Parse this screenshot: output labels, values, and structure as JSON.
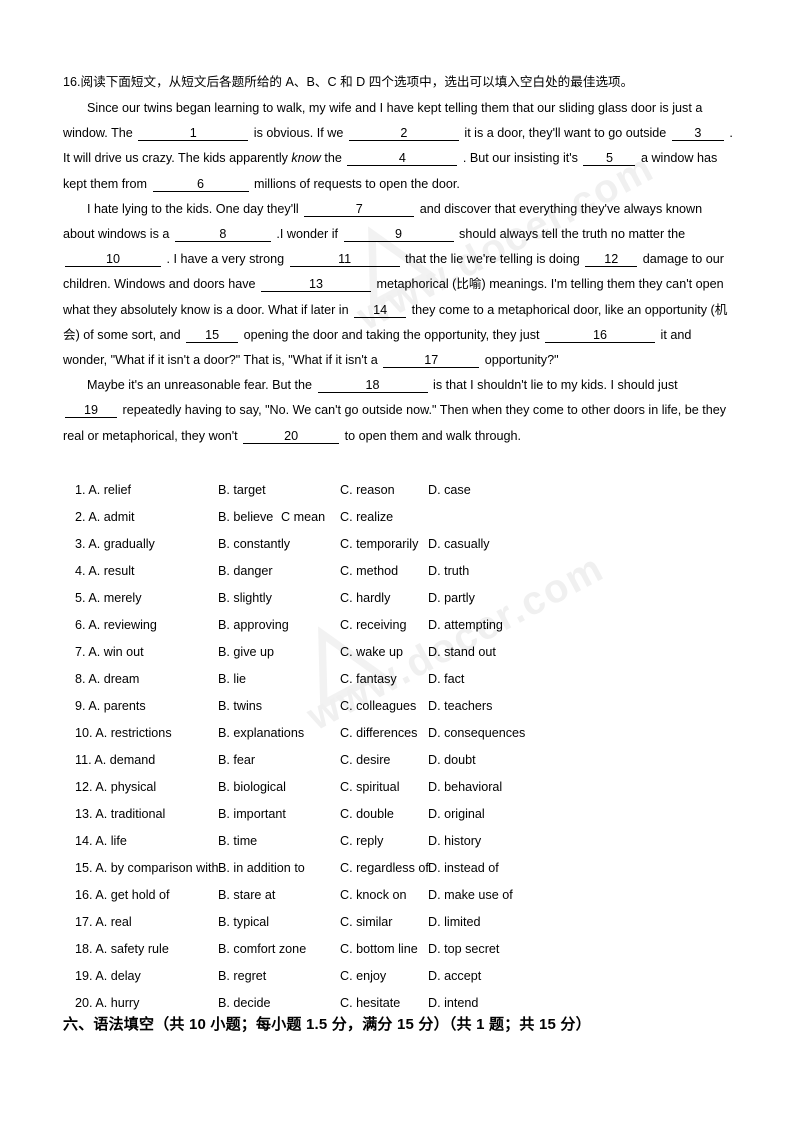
{
  "document": {
    "headline": "16.阅读下面短文，从短文后各题所给的 A、B、C 和 D 四个选项中，选出可以填入空白处的最佳选项。",
    "watermark": "www.docer.com"
  },
  "passage": {
    "p1": {
      "s1": "Since our twins began learning to walk, my wife and I have kept telling them that our sliding glass door is just a window. The",
      "s2": "is obvious. If we",
      "s3": "it is a door, they'll want to go outside",
      "s4": ". It will drive us crazy. The kids apparently",
      "s4_italic": "know",
      "s5": "the",
      "s6": ". But our insisting it's",
      "s7": "a window has kept them from",
      "s8": "millions of requests to open the door."
    },
    "p2": {
      "s1": "I hate lying to the kids. One day they'll",
      "s2": "and discover that everything they've always known about windows is a",
      "s3": ".I wonder if",
      "s4": "should always tell the truth no matter the",
      "s5": ". I have a very strong",
      "s6": "that the lie we're telling is doing",
      "s7": "damage to our children. Windows and doors have",
      "s8": "metaphorical (比喻) meanings. I'm telling them they can't open what they absolutely know is a door. What if later in",
      "s9": "they come to a metaphorical door, like an opportunity (机会) of some sort, and",
      "s10": "opening the door and taking the opportunity, they just",
      "s11": "it and wonder, \"What if it isn't a door?\" That is, \"What if it isn't a",
      "s12": "opportunity?\""
    },
    "p3": {
      "s1": "Maybe it's an unreasonable fear. But the",
      "s2": "is that I shouldn't lie to my kids. I should just",
      "s3": "repeatedly having to say, \"No. We can't go outside now.\" Then when they come to other doors in life, be they real or metaphorical, they won't",
      "s4": "to open them and walk through."
    },
    "blanks": [
      "1",
      "2",
      "3",
      "4",
      "5",
      "6",
      "7",
      "8",
      "9",
      "10",
      "11",
      "12",
      "13",
      "14",
      "15",
      "16",
      "17",
      "18",
      "19",
      "20"
    ]
  },
  "options": [
    {
      "num": "1.",
      "a": "A. relief",
      "b": "B. target",
      "c": "C. reason",
      "d": "D. case"
    },
    {
      "num": "2.",
      "a": "A. admit",
      "b": "B. believe",
      "c": "C. realize",
      "d": "",
      "extra": "C mean"
    },
    {
      "num": "3.",
      "a": "A. gradually",
      "b": "B. constantly",
      "c": "C. temporarily",
      "d": "D. casually"
    },
    {
      "num": "4.",
      "a": "A. result",
      "b": "B. danger",
      "c": "C. method",
      "d": "D. truth"
    },
    {
      "num": "5.",
      "a": "A. merely",
      "b": "B. slightly",
      "c": "C. hardly",
      "d": "D. partly"
    },
    {
      "num": "6.",
      "a": "A. reviewing",
      "b": "B. approving",
      "c": "C. receiving",
      "d": "D. attempting"
    },
    {
      "num": "7.",
      "a": "A. win out",
      "b": "B. give up",
      "c": "C. wake up",
      "d": "D. stand out"
    },
    {
      "num": "8.",
      "a": "A. dream",
      "b": "B. lie",
      "c": "C. fantasy",
      "d": "D. fact"
    },
    {
      "num": "9.",
      "a": "A. parents",
      "b": "B. twins",
      "c": "C. colleagues",
      "d": "D. teachers"
    },
    {
      "num": "10.",
      "a": "A. restrictions",
      "b": "B. explanations",
      "c": "C. differences",
      "d": "D. consequences"
    },
    {
      "num": "11.",
      "a": "A. demand",
      "b": "B. fear",
      "c": "C. desire",
      "d": "D. doubt"
    },
    {
      "num": "12.",
      "a": "A. physical",
      "b": "B. biological",
      "c": "C. spiritual",
      "d": "D. behavioral"
    },
    {
      "num": "13.",
      "a": "A. traditional",
      "b": "B. important",
      "c": "C. double",
      "d": "D. original"
    },
    {
      "num": "14.",
      "a": "A. life",
      "b": "B. time",
      "c": "C. reply",
      "d": "D. history"
    },
    {
      "num": "15.",
      "a": "A. by comparison with",
      "b": "B. in addition to",
      "c": "C. regardless of",
      "d": "D. instead of"
    },
    {
      "num": "16.",
      "a": "A. get hold of",
      "b": "B. stare at",
      "c": "C. knock on",
      "d": "D. make use of"
    },
    {
      "num": "17.",
      "a": "A. real",
      "b": "B. typical",
      "c": "C. similar",
      "d": "D. limited"
    },
    {
      "num": "18.",
      "a": "A. safety rule",
      "b": "B. comfort zone",
      "c": "C. bottom line",
      "d": "D. top secret"
    },
    {
      "num": "19.",
      "a": "A. delay",
      "b": "B. regret",
      "c": "C. enjoy",
      "d": "D. accept"
    },
    {
      "num": "20.",
      "a": "A. hurry",
      "b": "B. decide",
      "c": "C. hesitate",
      "d": "D. intend"
    }
  ],
  "footer": {
    "text": "六、语法填空（共 10 小题；每小题 1.5 分，满分 15 分）（共 1 题；共 15 分）"
  }
}
